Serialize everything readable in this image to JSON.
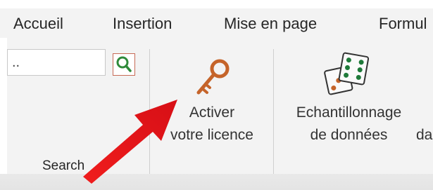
{
  "tabs": [
    {
      "label": "Accueil"
    },
    {
      "label": "Insertion"
    },
    {
      "label": "Mise en page"
    },
    {
      "label": "Formul"
    }
  ],
  "search": {
    "value": "..",
    "button_icon": "search-icon",
    "group_label": "Search"
  },
  "buttons": {
    "activate_license": {
      "line1": "Activer",
      "line2": "votre licence",
      "icon": "key-icon"
    },
    "data_sampling": {
      "line1": "Echantillonnage",
      "line2": "de données",
      "icon": "dice-icon"
    },
    "partial_next": {
      "label": "da"
    }
  },
  "overlay": {
    "arrow_icon": "red-pointer-arrow",
    "arrow_color": "#e8151a"
  },
  "colors": {
    "ribbon_background": "#f3f3f3",
    "key_color": "#c5642a",
    "search_icon_color": "#2f8a3a",
    "dice_dots_green": "#1f7a3a",
    "dice_dots_orange": "#c5642a"
  }
}
